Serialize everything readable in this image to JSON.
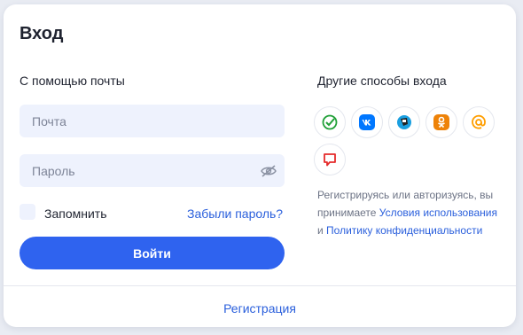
{
  "login": {
    "title": "Вход",
    "email_section_label": "С помощью почты",
    "email_placeholder": "Почта",
    "password_placeholder": "Пароль",
    "remember_label": "Запомнить",
    "forgot_label": "Забыли пароль?",
    "submit_label": "Войти",
    "register_label": "Регистрация"
  },
  "alt": {
    "label": "Другие способы входа",
    "providers": [
      "sber-icon",
      "vk-icon",
      "tinkoff-icon",
      "ok-icon",
      "mailru-icon",
      "pikabu-icon"
    ]
  },
  "legal": {
    "pre": "Регистрируясь или авторизуясь, вы принимаете ",
    "terms": "Условия использования",
    "and": " и ",
    "privacy": "Политику конфиденциальности"
  },
  "colors": {
    "accent": "#2f63ef",
    "link": "#2a5fdc",
    "input_bg": "#eef2fd"
  }
}
